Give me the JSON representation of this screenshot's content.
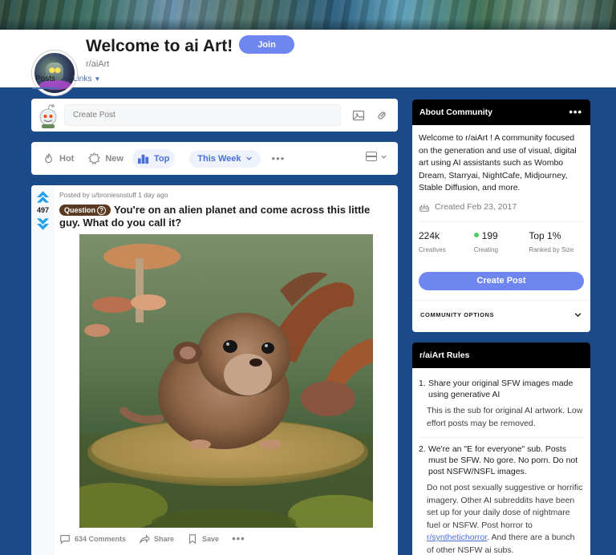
{
  "header": {
    "title": "Welcome to ai Art!",
    "subreddit": "r/aiArt",
    "join_label": "Join",
    "tabs": [
      {
        "label": "Posts"
      },
      {
        "label": "Links"
      }
    ]
  },
  "create_post": {
    "placeholder": "Create Post"
  },
  "sort_bar": {
    "hot": "Hot",
    "new": "New",
    "top": "Top",
    "time_range": "This Week"
  },
  "post": {
    "votes": "497",
    "meta": "Posted by u/broniesnstuff 1 day ago",
    "flair": "Question",
    "flair_icon": "?",
    "title": "You're on an alien planet and come across this little guy. What do you call it?",
    "comments": "634 Comments",
    "share": "Share",
    "save": "Save"
  },
  "about": {
    "heading": "About Community",
    "description": "Welcome to r/aiArt ! A community focused on the generation and use of visual, digital art using AI assistants such as Wombo Dream, Starryai, NightCafe, Midjourney, Stable Diffusion, and more.",
    "created": "Created Feb 23, 2017",
    "stats": [
      {
        "value": "224k",
        "label": "Creatives"
      },
      {
        "value": "199",
        "label": "Creating"
      },
      {
        "value": "Top 1%",
        "label": "Ranked by Size"
      }
    ],
    "create_post_label": "Create Post",
    "community_options": "COMMUNITY OPTIONS"
  },
  "rules": {
    "heading": "r/aiArt Rules",
    "items": [
      {
        "num": "1.",
        "title": "Share your original SFW images made using generative AI",
        "desc": "This is the sub for original AI artwork. Low effort posts may be removed."
      },
      {
        "num": "2.",
        "title": "We're an \"E for everyone\" sub. Posts must be SFW. No gore. No porn. Do not post NSFW/NSFL images.",
        "desc_before": "Do not post sexually suggestive or horrific imagery. Other AI subreddits have been set up for your daily dose of nightmare fuel or NSFW. Post horror to ",
        "desc_link": "r/synthetichorror",
        "desc_after": ". And there are a bunch of other NSFW ai subs."
      }
    ]
  },
  "colors": {
    "page_bg": "#1b4a8a",
    "accent": "#6f85f0",
    "vote_arrow": "#24a0ed",
    "online": "#46d160"
  }
}
